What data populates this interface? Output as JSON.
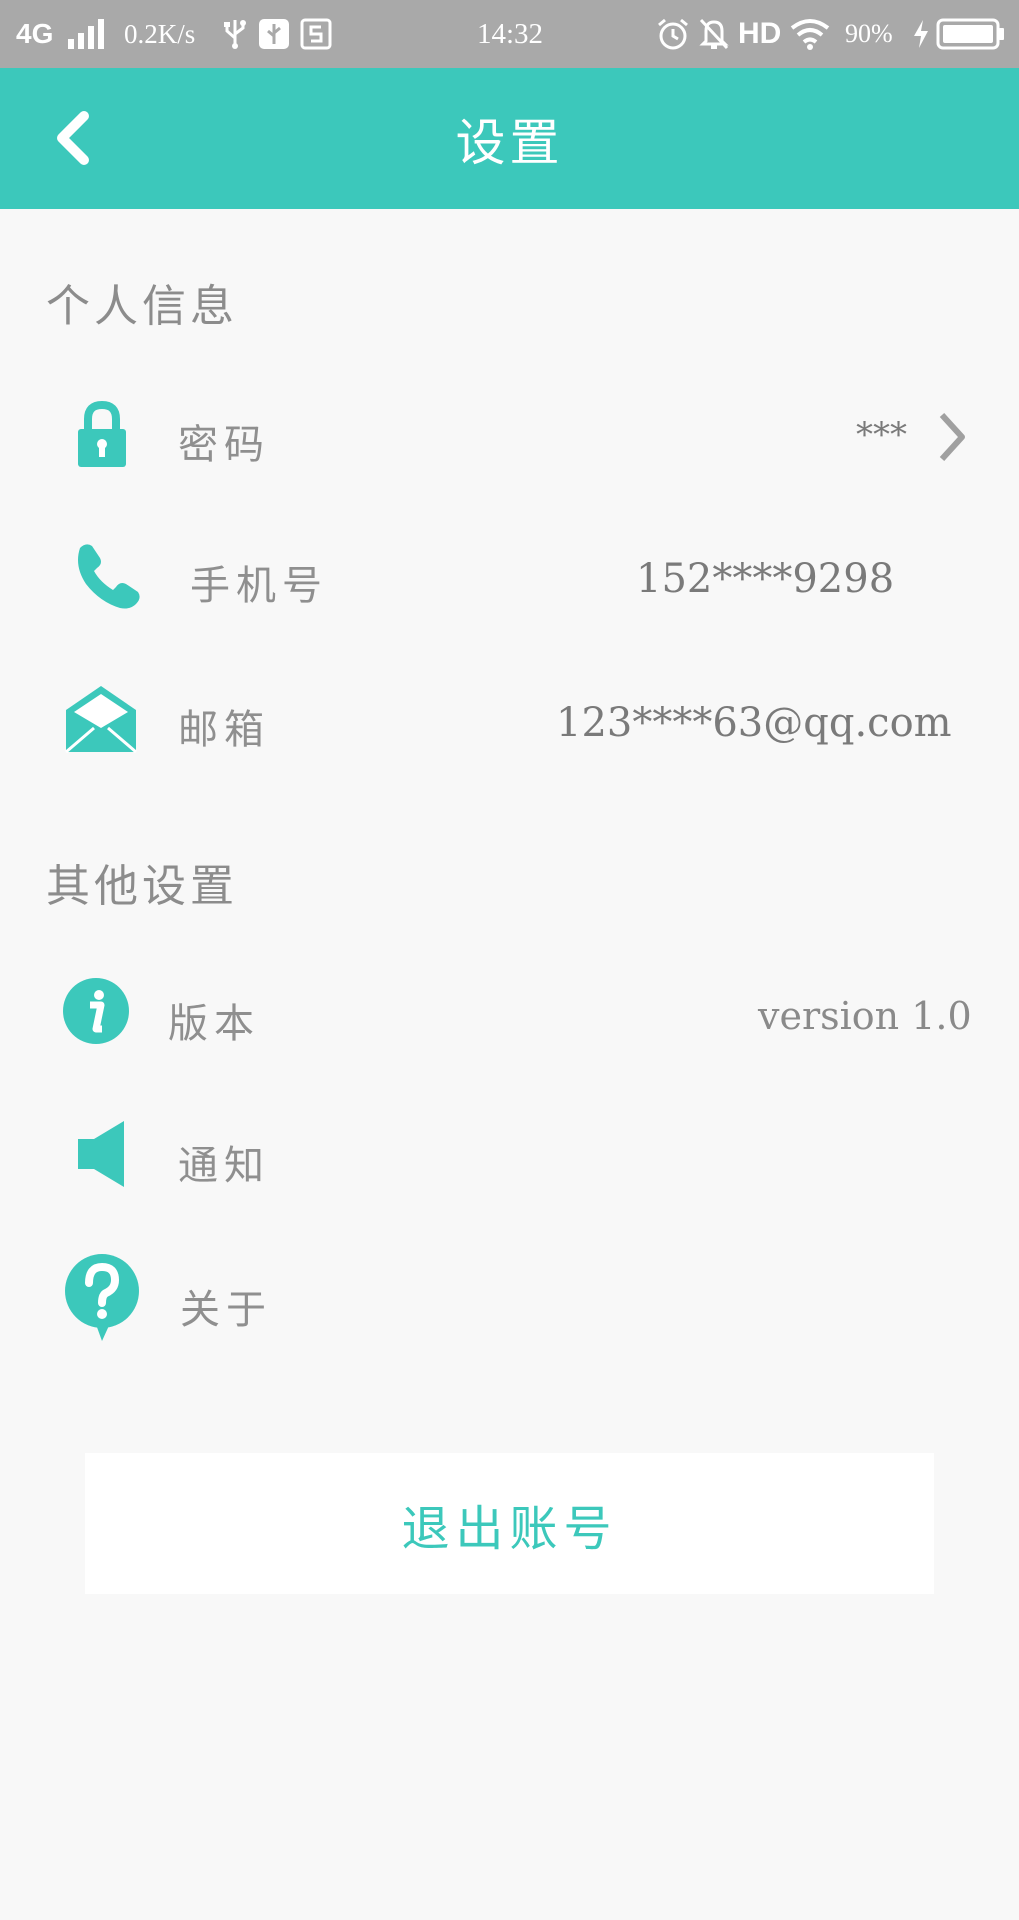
{
  "status_bar": {
    "network": "4G",
    "speed": "0.2K/s",
    "time": "14:32",
    "hd": "HD",
    "battery": "90%",
    "icons": [
      "signal-icon",
      "usb-icon",
      "usb-debug-icon",
      "screenshot-icon",
      "alarm-icon",
      "mute-icon",
      "wifi-icon",
      "charging-icon",
      "battery-icon"
    ]
  },
  "header": {
    "title": "设置"
  },
  "sections": {
    "personal": {
      "title": "个人信息",
      "password": {
        "label": "密码",
        "value": "***"
      },
      "phone": {
        "label": "手机号",
        "value": "152****9298"
      },
      "email": {
        "label": "邮箱",
        "value": "123****63@qq.com"
      }
    },
    "other": {
      "title": "其他设置",
      "version": {
        "label": "版本",
        "value": "version 1.0"
      },
      "notify": {
        "label": "通知"
      },
      "about": {
        "label": "关于"
      }
    }
  },
  "logout_label": "退出账号",
  "colors": {
    "accent": "#3cc8bb",
    "status_bar": "#a9a9a9",
    "background": "#f8f8f8",
    "text": "#8f8f8f"
  }
}
